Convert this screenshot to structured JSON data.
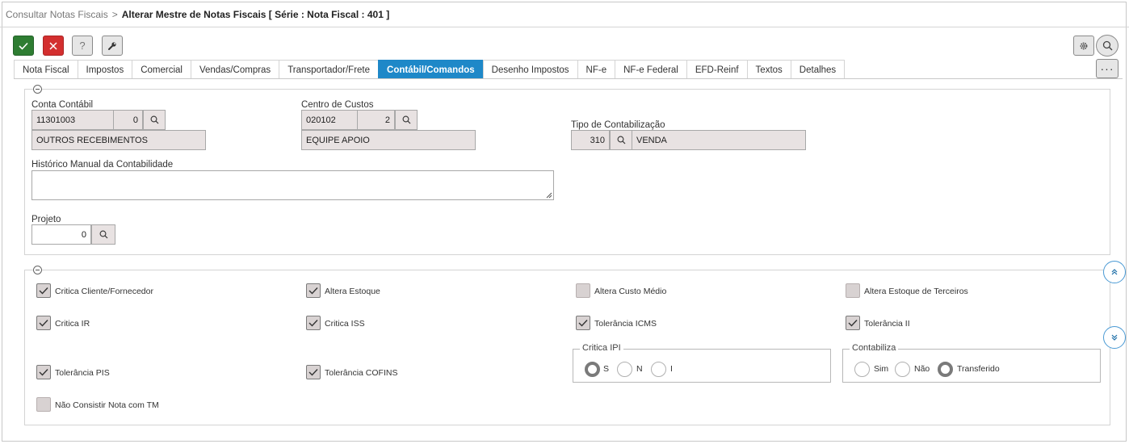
{
  "breadcrumb": {
    "parent": "Consultar Notas Fiscais",
    "separator": ">",
    "current": "Alterar Mestre de Notas Fiscais [ Série : Nota Fiscal : 401 ]"
  },
  "toolbar": {
    "confirm_icon": "check-icon",
    "cancel_icon": "close-icon",
    "help_label": "?",
    "tools_icon": "wrench-icon",
    "settings_icon": "gear-icon",
    "search_icon": "search-icon",
    "more_label": "···"
  },
  "tabs": [
    {
      "label": "Nota Fiscal",
      "active": false
    },
    {
      "label": "Impostos",
      "active": false
    },
    {
      "label": "Comercial",
      "active": false
    },
    {
      "label": "Vendas/Compras",
      "active": false
    },
    {
      "label": "Transportador/Frete",
      "active": false
    },
    {
      "label": "Contábil/Comandos",
      "active": true
    },
    {
      "label": "Desenho Impostos",
      "active": false
    },
    {
      "label": "NF-e",
      "active": false
    },
    {
      "label": "NF-e Federal",
      "active": false
    },
    {
      "label": "EFD-Reinf",
      "active": false
    },
    {
      "label": "Textos",
      "active": false
    },
    {
      "label": "Detalhes",
      "active": false
    }
  ],
  "accounting": {
    "conta_contabil": {
      "label": "Conta Contábil",
      "code": "11301003",
      "digit": "0",
      "description": "OUTROS RECEBIMENTOS"
    },
    "centro_custos": {
      "label": "Centro de Custos",
      "code": "020102",
      "digit": "2",
      "description": "EQUIPE APOIO"
    },
    "tipo_contabilizacao": {
      "label": "Tipo de Contabilização",
      "code": "310",
      "description": "VENDA"
    },
    "historico": {
      "label": "Histórico Manual da Contabilidade",
      "value": ""
    },
    "projeto": {
      "label": "Projeto",
      "value": "0"
    }
  },
  "flags": {
    "critica_cliente": {
      "label": "Critica Cliente/Fornecedor",
      "checked": true
    },
    "altera_estoque": {
      "label": "Altera Estoque",
      "checked": true
    },
    "altera_custo_medio": {
      "label": "Altera Custo Médio",
      "checked": false
    },
    "altera_estoque_terceiros": {
      "label": "Altera Estoque de Terceiros",
      "checked": false
    },
    "critica_ir": {
      "label": "Critica IR",
      "checked": true
    },
    "critica_iss": {
      "label": "Critica ISS",
      "checked": true
    },
    "tolerancia_icms": {
      "label": "Tolerância ICMS",
      "checked": true
    },
    "tolerancia_ii": {
      "label": "Tolerância II",
      "checked": true
    },
    "tolerancia_pis": {
      "label": "Tolerância PIS",
      "checked": true
    },
    "tolerancia_cofins": {
      "label": "Tolerância COFINS",
      "checked": true
    },
    "nao_consistir": {
      "label": "Não Consistir Nota com TM",
      "checked": false
    }
  },
  "critica_ipi": {
    "title": "Critica IPI",
    "options": [
      {
        "label": "S",
        "selected": true
      },
      {
        "label": "N",
        "selected": false
      },
      {
        "label": "I",
        "selected": false
      }
    ]
  },
  "contabiliza": {
    "title": "Contabiliza",
    "options": [
      {
        "label": "Sim",
        "selected": false
      },
      {
        "label": "Não",
        "selected": false
      },
      {
        "label": "Transferido",
        "selected": true
      }
    ]
  },
  "colors": {
    "accent": "#1e88c8",
    "confirm": "#2e7d32",
    "cancel": "#d32f2f",
    "readonly_field": "#e8e2e2"
  }
}
